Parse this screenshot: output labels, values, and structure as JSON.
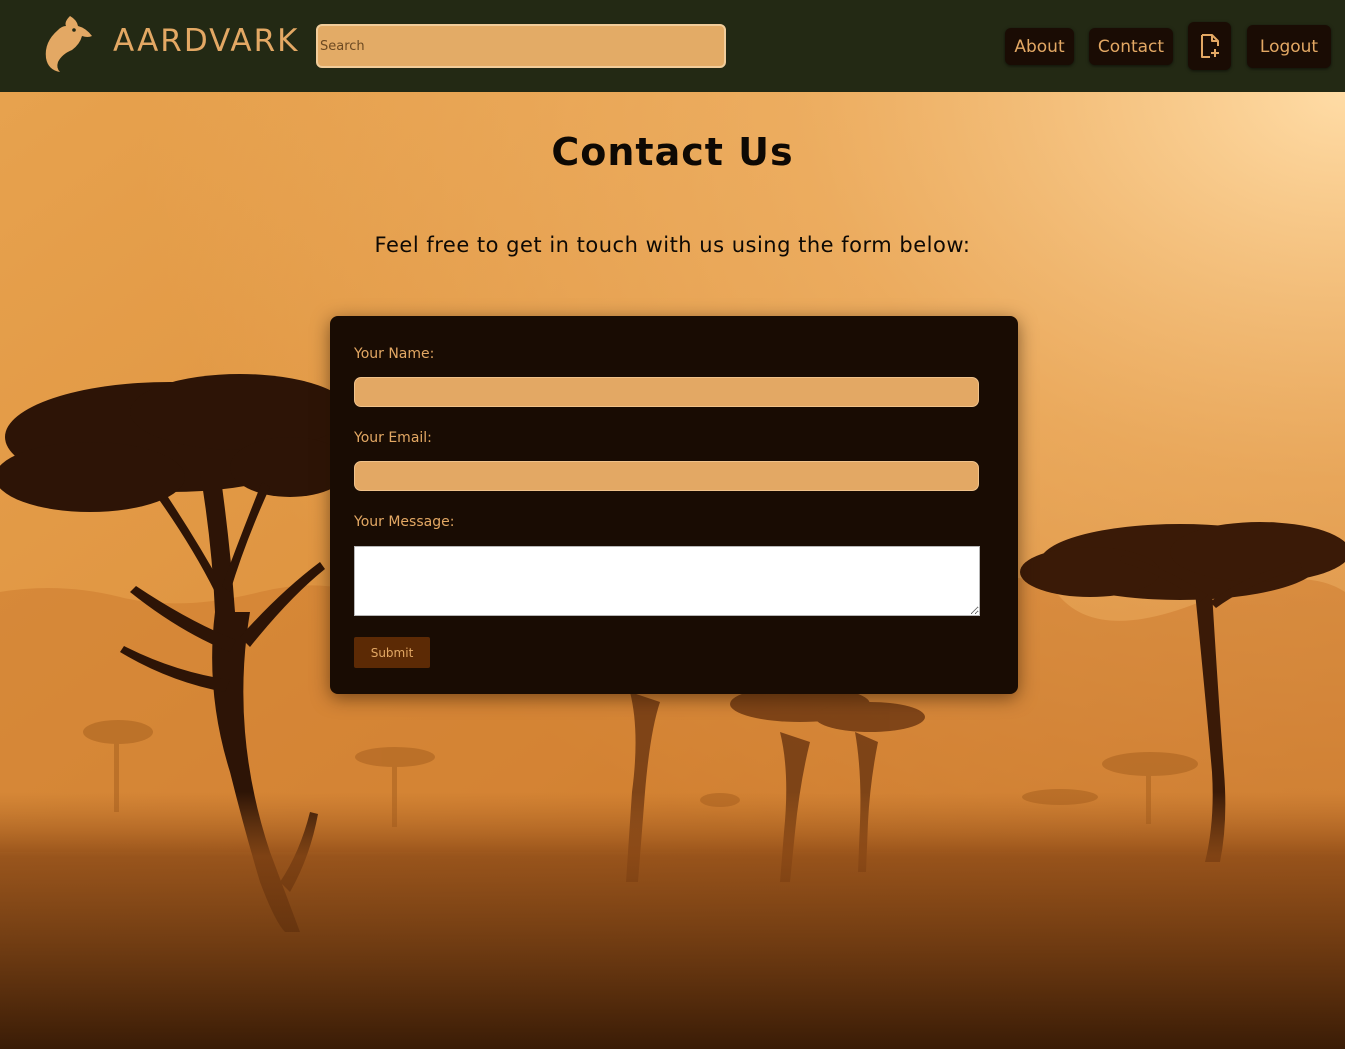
{
  "navbar": {
    "brand": "AARDVARK",
    "search_placeholder": "Search",
    "about_label": "About",
    "contact_label": "Contact",
    "new_document_icon": "file-plus-icon",
    "logout_label": "Logout"
  },
  "main": {
    "title": "Contact Us",
    "subtitle": "Feel free to get in touch with us using the form below:"
  },
  "form": {
    "name_label": "Your Name:",
    "name_value": "",
    "email_label": "Your Email:",
    "email_value": "",
    "message_label": "Your Message:",
    "message_value": "",
    "submit_label": "Submit"
  },
  "colors": {
    "navbar_bg": "#232914",
    "accent": "#e3a864",
    "button_dark": "#1a0c04",
    "form_bg": "#190c03",
    "submit_bg": "#5c2a05"
  }
}
